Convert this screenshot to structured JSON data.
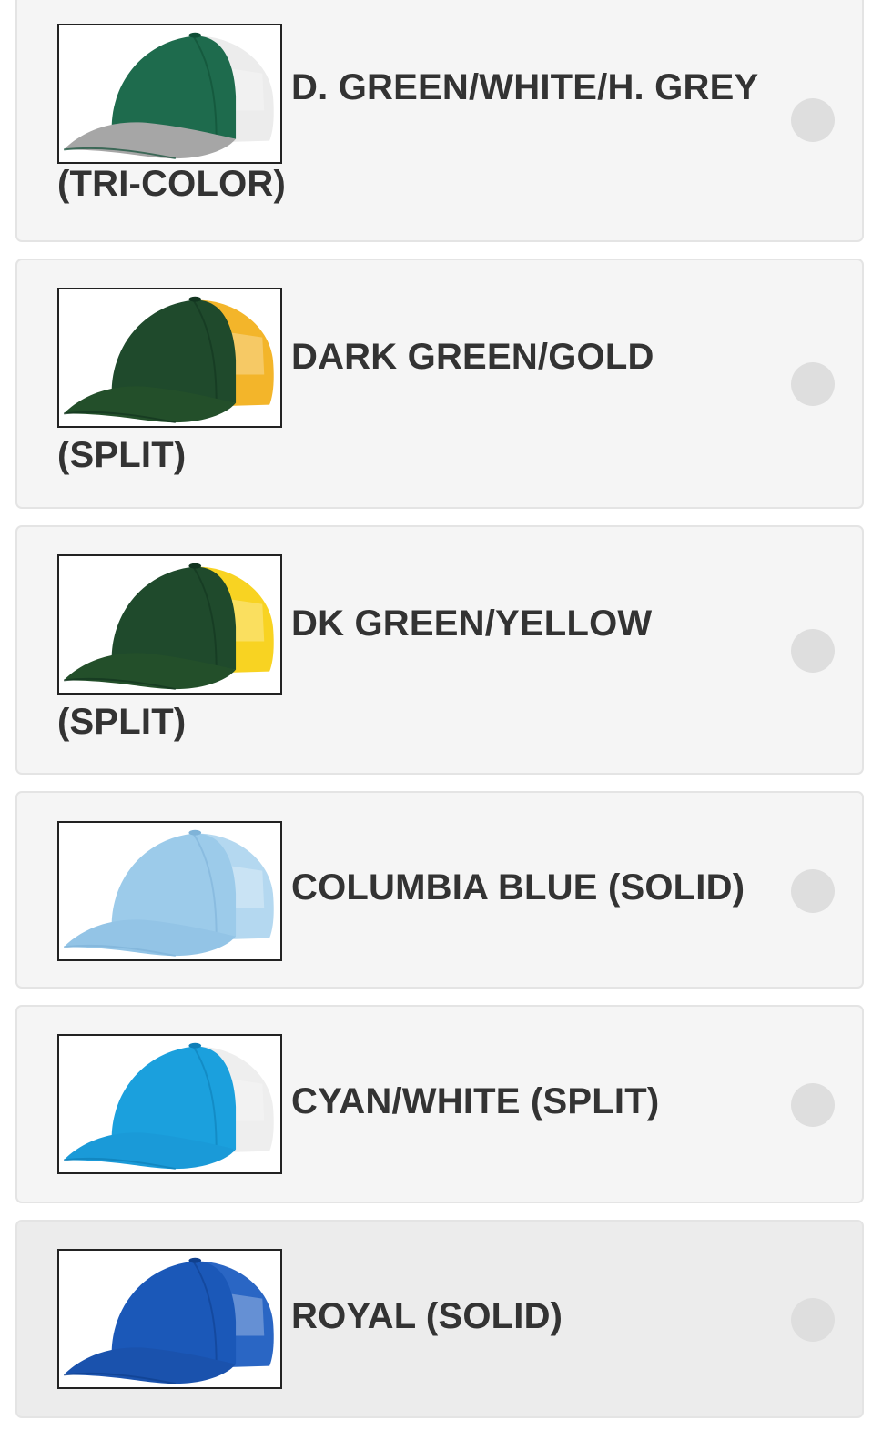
{
  "options": [
    {
      "name_line1": "D. GREEN/WHITE/H. GREY",
      "name_line2": "(TRI-COLOR)",
      "icon": "trucker-cap-image",
      "colors": {
        "crown": "#1e6b4d",
        "mesh": "#ececec",
        "bill": "#a6a6a6",
        "seam": "#0f4e36"
      },
      "selected": false
    },
    {
      "name_line1": "DARK GREEN/GOLD",
      "name_line2": "(SPLIT)",
      "icon": "trucker-cap-image",
      "colors": {
        "crown": "#1f4a2c",
        "mesh": "#f3b52a",
        "bill": "#234f2a",
        "seam": "#123520"
      },
      "selected": false
    },
    {
      "name_line1": "DK GREEN/YELLOW",
      "name_line2": "(SPLIT)",
      "icon": "trucker-cap-image",
      "colors": {
        "crown": "#1f4a2c",
        "mesh": "#f8d322",
        "bill": "#234f2a",
        "seam": "#123520"
      },
      "selected": false
    },
    {
      "name_line1": "COLUMBIA BLUE (SOLID)",
      "name_line2": "",
      "icon": "trucker-cap-image",
      "colors": {
        "crown": "#9ccbea",
        "mesh": "#b4d8f0",
        "bill": "#93c4e6",
        "seam": "#7fb3d8"
      },
      "selected": false
    },
    {
      "name_line1": "CYAN/WHITE (SPLIT)",
      "name_line2": "",
      "icon": "trucker-cap-image",
      "colors": {
        "crown": "#1ba0dd",
        "mesh": "#eeeeee",
        "bill": "#1a9ad8",
        "seam": "#0f7fb8"
      },
      "selected": false
    },
    {
      "name_line1": "ROYAL (SOLID)",
      "name_line2": "",
      "icon": "trucker-cap-image",
      "colors": {
        "crown": "#1b58b8",
        "mesh": "#2a66c4",
        "bill": "#1a52ad",
        "seam": "#10408d"
      },
      "selected": false
    }
  ]
}
